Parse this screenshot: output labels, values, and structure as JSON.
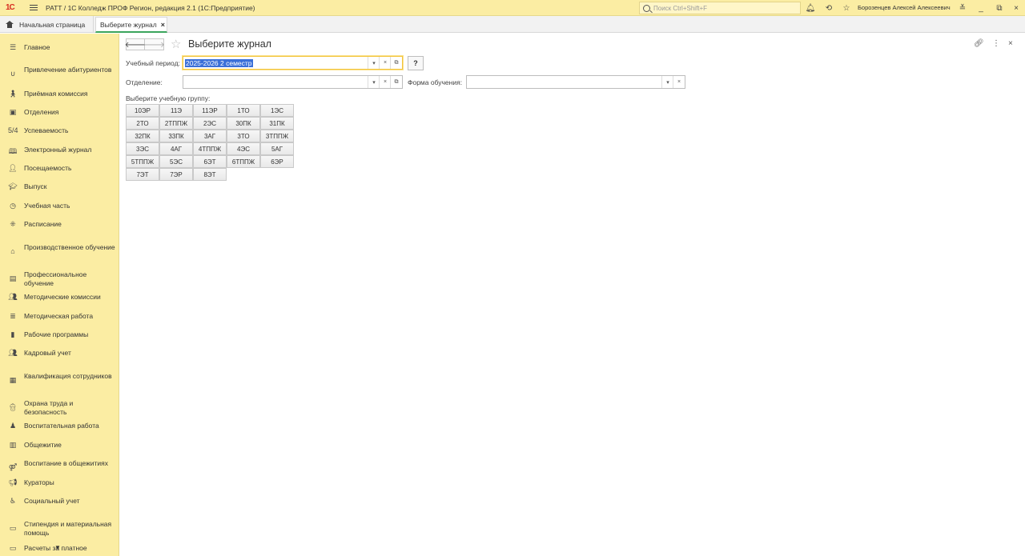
{
  "titlebar": {
    "logo": "1С",
    "title": "РАТТ / 1С Колледж ПРОФ Регион, редакция 2.1  (1С:Предприятие)",
    "search_placeholder": "Поиск Ctrl+Shift+F",
    "user": "Борозенцев Алексей Алексеевич"
  },
  "tabs": {
    "home": "Начальная страница",
    "active": "Выберите журнал",
    "close": "×"
  },
  "sidebar": {
    "items": [
      {
        "label": "Главное",
        "icon": "menu-icon"
      },
      {
        "label": "Привлечение абитуриентов",
        "icon": "magnet-icon"
      },
      {
        "label": "Приёмная комиссия",
        "icon": "walking-person-icon"
      },
      {
        "label": "Отделения",
        "icon": "building-icon"
      },
      {
        "label": "Успеваемость",
        "icon": "fraction-icon"
      },
      {
        "label": "Электронный журнал",
        "icon": "book-icon"
      },
      {
        "label": "Посещаемость",
        "icon": "person-desk-icon"
      },
      {
        "label": "Выпуск",
        "icon": "graduation-cap-icon"
      },
      {
        "label": "Учебная часть",
        "icon": "clock-icon"
      },
      {
        "label": "Расписание",
        "icon": "schedule-icon"
      },
      {
        "label": "Производственное обучение",
        "icon": "factory-icon"
      },
      {
        "label": "Профессиональное обучение",
        "icon": "bus-icon"
      },
      {
        "label": "Методические комиссии",
        "icon": "group-icon"
      },
      {
        "label": "Методическая работа",
        "icon": "list-icon"
      },
      {
        "label": "Рабочие программы",
        "icon": "document-icon"
      },
      {
        "label": "Кадровый учет",
        "icon": "people-icon"
      },
      {
        "label": "Квалификация сотрудников",
        "icon": "certificate-icon"
      },
      {
        "label": "Охрана труда и безопасность",
        "icon": "worker-icon"
      },
      {
        "label": "Воспитательная работа",
        "icon": "teacher-icon"
      },
      {
        "label": "Общежитие",
        "icon": "dormitory-icon"
      },
      {
        "label": "Воспитание в общежитиях",
        "icon": "couple-icon"
      },
      {
        "label": "Кураторы",
        "icon": "megaphone-icon"
      },
      {
        "label": "Социальный учет",
        "icon": "wheelchair-icon"
      },
      {
        "label": "Стипендия и материальная помощь",
        "icon": "wallet-icon"
      },
      {
        "label": "Расчеты за платное",
        "icon": "payment-icon"
      }
    ]
  },
  "main": {
    "title": "Выберите журнал",
    "period_label": "Учебный период:",
    "period_value": "2025-2026 2 семестр",
    "help": "?",
    "department_label": "Отделение:",
    "department_value": "",
    "form_label": "Форма обучения:",
    "form_value": "",
    "group_label": "Выберите учебную группу:",
    "groups": [
      [
        "10ЭР",
        "11Э",
        "11ЭР",
        "1ТО",
        "1ЭС"
      ],
      [
        "2ТО",
        "2ТППЖ",
        "2ЭС",
        "30ПК",
        "31ПК"
      ],
      [
        "32ПК",
        "33ПК",
        "3АГ",
        "3ТО",
        "3ТППЖ"
      ],
      [
        "3ЭС",
        "4АГ",
        "4ТППЖ",
        "4ЭС",
        "5АГ"
      ],
      [
        "5ТППЖ",
        "5ЭС",
        "6ЭТ",
        "6ТППЖ",
        "6ЭР"
      ],
      [
        "7ЭТ",
        "7ЭР",
        "8ЭТ"
      ]
    ]
  }
}
